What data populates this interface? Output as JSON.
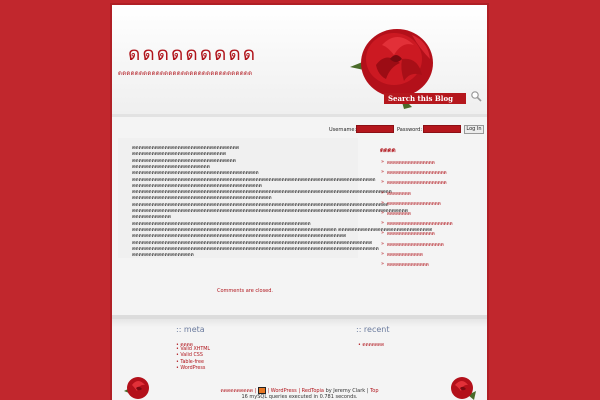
{
  "header": {
    "title": "ดดดดดดดดด",
    "description": "ดดดดดดดดดดดดดดดดดดดดดดดดดดดดดดดด",
    "search_label": "Search this Blog"
  },
  "login": {
    "username_label": "Username:",
    "password_label": "Password:",
    "login_button": "Log In"
  },
  "content": {
    "lines": [
      "ดดดดดดดดดดดดดดดดดดดดดดดดดดดดดดดดด",
      "ดดดดดดดดดดดดดดดดดดดดดดดดดดดดด",
      "ดดดดดดดดดดดดดดดดดดดดดดดดดดดดดดดด",
      "ดดดดดดดดดดดดดดดดดดดดดดดด",
      "ดดดดดดดดดดดดดดดดดดดดดดดดดดดดดดดดดดดดดดด",
      "ดดดดดดดดดดดดดดดดดดดดดดดดดดดดดดดดดดดดดดดดดดดดดดดดดดดดดดดดดดดดดดดดดดดดดดดดดดด",
      "ดดดดดดดดดดดดดดดดดดดดดดดดดดดดดดดดดดดดดดดด",
      "ดดดดดดดดดดดดดดดดดดดดดดดดดดดดดดดดดดดดดดดดดดดดดดดดดดดดดดดดดดดดดดดดดดดดดดดดดดดดดดดด",
      "ดดดดดดดดดดดดดดดดดดดดดดดดดดดดดดดดดดดดดดดดดดด",
      "ดดดดดดดดดดดดดดดดดดดดดดดดดดดดดดดดดดดดดดดดดดดดดดดดดดดดดดดดดดดดดดดดดดดดดดดดดดดดดดด",
      "ดดดดดดดดดดดดดดดดดดดดดดดดดดดดดดดดดดดดดดดดดดดดดดดดดดดดดดดดดดดดดดดดดดดดดดดดดดดดดดดดดดดดด",
      "ดดดดดดดดดดดด",
      "ดดดดดดดดดดดดดดดดดดดดดดดดดดดดดดดดดดดดดดดดดดดดดดดดดดดดดดด",
      "ดดดดดดดดดดดดดดดดดดดดดดดดดดดดดดดดดดดดดดดดดดดดดดดดดดดดดดดดดดดดดดด ดดดดดดดดดดดดดดดดดดดดดดดดดดดดด",
      "ดดดดดดดดดดดดดดดดดดดดดดดดดดดดดดดดดดดดดดดดดดดดดดดดดดดดดดดดดดดดดดดดดด",
      "ดดดดดดดดดดดดดดดดดดดดดดดดดดดดดดดดดดดดดดดดดดดดดดดดดดดดดดดดดดดดดดดดดดดดดดดดดด",
      "ดดดดดดดดดดดดดดดดดดดดดดดดดดดดดดดดดดดดดดดดดดดดดดดดดดดดดดดดดดดดดดดดดดดดดดดดดดดด",
      "ดดดดดดดดดดดดดดดดดดด"
    ],
    "comments_closed": "Comments are closed."
  },
  "sidebar": {
    "title": "ดดดด",
    "items": [
      "ดดดดดดดดดดดดดดดด",
      "ดดดดดดดดดดดดดดดดดดดด",
      "ดดดดดดดดดดดดดดดดดดดด",
      "ดดดดดดดด",
      "ดดดดดดดดดดดดดดดดดด",
      "ดดดดดดดด",
      "ดดดดดดดดดดดดดดดดดดดดดด",
      "ดดดดดดดดดดดดดดดด",
      "ดดดดดดดดดดดดดดดดดดด",
      "ดดดดดดดดดดดด",
      "ดดดดดดดดดดดดดด"
    ]
  },
  "footer": {
    "meta_title": ":: meta",
    "meta_items": [
      "ดดดด",
      "Valid XHTML",
      "Valid CSS",
      "Table-free",
      "WordPress"
    ],
    "recent_title": ":: recent",
    "recent_items": [
      "ดดดดดดด"
    ],
    "credit_blog": "ดดดดดดดดดด",
    "credit_sep1": " | ",
    "credit_wordpress": "WordPress",
    "credit_sep2": " | ",
    "credit_theme": "RedTopia",
    "credit_by": " by Jeremy Clark | ",
    "credit_top": "Top",
    "queries": "16 mySQL queries executed in 0.781 seconds."
  }
}
